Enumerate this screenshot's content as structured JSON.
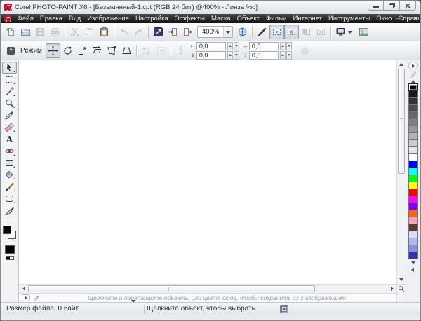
{
  "window": {
    "title": "Corel PHOTO-PAINT X6 - [Безымянный-1.cpt (RGB 24 бит) @400% - Линза %d]"
  },
  "menu": {
    "items": [
      {
        "id": "file",
        "label": "Файл"
      },
      {
        "id": "edit",
        "label": "Правка"
      },
      {
        "id": "view",
        "label": "Вид"
      },
      {
        "id": "image",
        "label": "Изображение"
      },
      {
        "id": "adjust",
        "label": "Настройка"
      },
      {
        "id": "effects",
        "label": "Эффекты"
      },
      {
        "id": "mask",
        "label": "Маска"
      },
      {
        "id": "object",
        "label": "Объект"
      },
      {
        "id": "movie",
        "label": "Фильм"
      },
      {
        "id": "internet",
        "label": "Интернет"
      },
      {
        "id": "tools",
        "label": "Инструменты"
      },
      {
        "id": "window",
        "label": "Окно"
      },
      {
        "id": "help",
        "label": "Справка"
      }
    ]
  },
  "toolbar": {
    "zoom_level": "400%",
    "buttons": [
      {
        "id": "new",
        "icon": "new-doc"
      },
      {
        "id": "open",
        "icon": "open-folder"
      },
      {
        "id": "save",
        "icon": "save-floppy",
        "state": "disabled"
      },
      {
        "id": "print",
        "icon": "printer",
        "state": "disabled"
      },
      {
        "sep": true
      },
      {
        "id": "cut",
        "icon": "scissors",
        "state": "disabled"
      },
      {
        "id": "copy",
        "icon": "copy-pages",
        "state": "disabled"
      },
      {
        "id": "paste",
        "icon": "clipboard"
      },
      {
        "sep": true
      },
      {
        "id": "undo",
        "icon": "undo-arrow",
        "state": "disabled"
      },
      {
        "id": "redo",
        "icon": "redo-arrow",
        "state": "disabled"
      },
      {
        "sep": true
      },
      {
        "id": "search-content",
        "icon": "connect"
      },
      {
        "id": "import",
        "icon": "import-page"
      },
      {
        "id": "export",
        "icon": "export-page"
      },
      {
        "type": "zoom-combo"
      },
      {
        "id": "zoom-fit",
        "icon": "fit-zoom"
      },
      {
        "sep": true
      },
      {
        "id": "full-screen-preview",
        "icon": "brush-preview"
      },
      {
        "id": "show-mask-marquee",
        "icon": "mask-marquee",
        "state": "pressed"
      },
      {
        "id": "show-object-marquee",
        "icon": "object-marquee",
        "state": "pressed"
      },
      {
        "id": "invert-mask",
        "icon": "invert-mask",
        "state": "disabled"
      },
      {
        "id": "clear-mask",
        "icon": "clear-mask",
        "state": "disabled"
      },
      {
        "sep": true
      },
      {
        "id": "proof-colors",
        "icon": "proof-monitor",
        "dropdown": true
      },
      {
        "id": "welcome-screen",
        "icon": "welcome-image"
      }
    ]
  },
  "property_bar": {
    "mode_label": "Режим",
    "buttons": [
      {
        "id": "help",
        "icon": "help-badge"
      },
      {
        "type": "label"
      },
      {
        "id": "mode-position",
        "icon": "mode-position",
        "state": "pressed"
      },
      {
        "id": "mode-rotate",
        "icon": "mode-rotate"
      },
      {
        "id": "mode-scale",
        "icon": "mode-scale"
      },
      {
        "id": "mode-skew",
        "icon": "mode-skew"
      },
      {
        "id": "mode-distort",
        "icon": "mode-distort"
      },
      {
        "id": "mode-perspective",
        "icon": "mode-perspective"
      },
      {
        "sep": true
      },
      {
        "id": "apply-to-duplicate",
        "icon": "apply-duplicate",
        "state": "disabled"
      },
      {
        "id": "transform-mask",
        "icon": "transform-mask",
        "state": "disabled"
      },
      {
        "sep": true
      },
      {
        "id": "anchor-point",
        "icon": "anchor-pin",
        "state": "disabled"
      }
    ],
    "fields": {
      "pos_x": "0,0",
      "pos_y": "0,0",
      "size_w": "0,0",
      "size_h": "0,0"
    }
  },
  "toolbox": {
    "tools": [
      {
        "id": "pick",
        "icon": "tool-pick",
        "selected": true,
        "flyout": true
      },
      {
        "id": "rectangle-mask",
        "icon": "tool-mask-rect",
        "flyout": true
      },
      {
        "id": "magic-wand-mask",
        "icon": "tool-wand",
        "flyout": true
      },
      {
        "id": "zoom",
        "icon": "tool-zoom",
        "flyout": true
      },
      {
        "id": "eyedropper",
        "icon": "tool-eyedropper"
      },
      {
        "id": "eraser",
        "icon": "tool-eraser",
        "flyout": true
      },
      {
        "id": "text",
        "icon": "tool-text"
      },
      {
        "id": "red-eye-removal",
        "icon": "tool-redeye",
        "flyout": true
      },
      {
        "id": "rectangle",
        "icon": "tool-rectangle",
        "flyout": true
      },
      {
        "id": "fill",
        "icon": "tool-fill",
        "flyout": true
      },
      {
        "id": "paint",
        "icon": "tool-paint",
        "flyout": true
      },
      {
        "id": "shape",
        "icon": "tool-shape",
        "flyout": true
      },
      {
        "id": "image-knife",
        "icon": "tool-knife"
      }
    ],
    "colors": {
      "foreground": "#000000",
      "background": "#FFFFFF",
      "fill": "#000000"
    }
  },
  "palette": {
    "selected_index": 0,
    "colors": [
      "#000000",
      "#1A1A1A",
      "#333333",
      "#4D4D4D",
      "#666666",
      "#808080",
      "#999999",
      "#B3B3B3",
      "#CCCCCC",
      "#E6E6E6",
      "#FFFFFF",
      "#0000FF",
      "#00FFFF",
      "#00FF00",
      "#FFFF00",
      "#FF0000",
      "#FF00FF",
      "#7F00FF",
      "#FF6600",
      "#FF9EB5",
      "#5C3A2E",
      "#DCDCF5",
      "#B4B7EC",
      "#8A8FE0",
      "#2F35B5"
    ]
  },
  "image_palette_bar": {
    "hint": "Щелкните и перетащите объекты или цвета сюда, чтобы сохранить их с изображением"
  },
  "status_bar": {
    "file_size": "Размер файла: 0 байт",
    "hint": "Щелкните объект, чтобы выбрать"
  }
}
